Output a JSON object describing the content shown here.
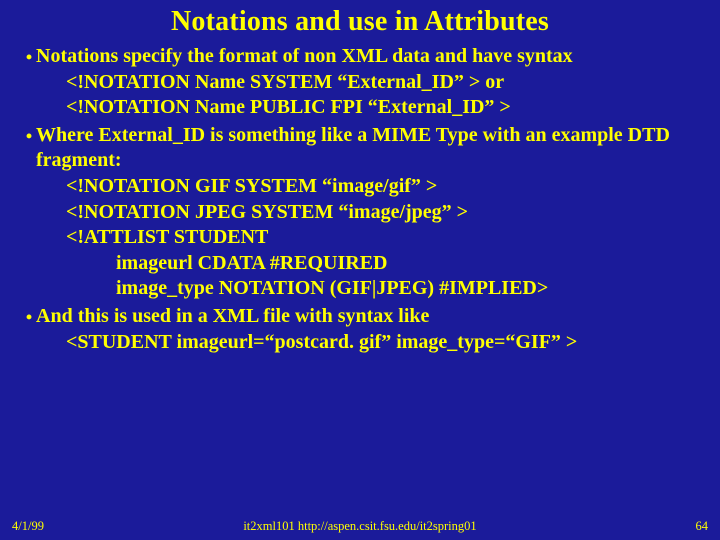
{
  "title": "Notations and use in Attributes",
  "bullets": [
    {
      "lead": "Notations specify the format of non XML data and have syntax",
      "lines": [
        {
          "cls": "indent1",
          "text": "<!NOTATION Name SYSTEM “External_ID” > or"
        },
        {
          "cls": "indent1",
          "text": " <!NOTATION Name PUBLIC FPI “External_ID” >"
        }
      ]
    },
    {
      "lead": "Where External_ID is something like a MIME Type with an example DTD fragment:",
      "lines": [
        {
          "cls": "indent1",
          "text": "<!NOTATION GIF SYSTEM “image/gif” >"
        },
        {
          "cls": "indent1",
          "text": "<!NOTATION JPEG SYSTEM “image/jpeg” >"
        },
        {
          "cls": "indent1",
          "text": "<!ATTLIST STUDENT"
        },
        {
          "cls": "indent2",
          "text": "imageurl CDATA #REQUIRED"
        },
        {
          "cls": "indent2",
          "text": "image_type NOTATION (GIF|JPEG) #IMPLIED>"
        }
      ]
    },
    {
      "lead": "And this is used in a XML file with syntax like",
      "lines": [
        {
          "cls": "indent1",
          "text": "<STUDENT imageurl=“postcard. gif” image_type=“GIF” >"
        }
      ]
    }
  ],
  "footer": {
    "left": "4/1/99",
    "center": "it2xml101  http://aspen.csit.fsu.edu/it2spring01",
    "right": "64"
  }
}
